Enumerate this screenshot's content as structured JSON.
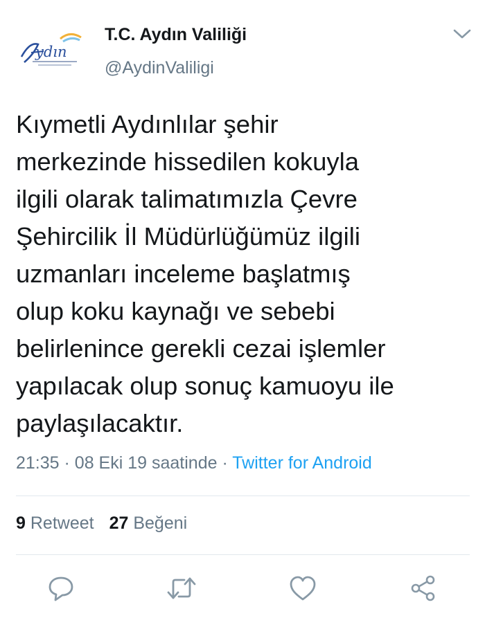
{
  "account": {
    "display_name": "T.C. Aydın Valiliği",
    "handle": "@AydinValiligi",
    "avatar_icon": "aydin-logo-icon"
  },
  "tweet": {
    "text": "Kıymetli Aydınlılar şehir\nmerkezinde hissedilen kokuyla\nilgili olarak talimatımızla Çevre\nŞehircilik İl Müdürlüğümüz ilgili\nuzmanları inceleme başlatmış\nolup koku kaynağı ve sebebi\nbelirlenince gerekli cezai işlemler\nyapılacak olup sonuç kamuoyu ile\npaylaşılacaktır.",
    "time": "21:35",
    "date": "08 Eki 19 saatinde",
    "separator": "·",
    "source": "Twitter for Android"
  },
  "stats": {
    "retweet_count": "9",
    "retweet_label": "Retweet",
    "like_count": "27",
    "like_label": "Beğeni"
  },
  "actions": [
    "reply-icon",
    "retweet-icon",
    "like-icon",
    "share-icon"
  ],
  "colors": {
    "text": "#14171a",
    "secondary": "#657786",
    "link": "#1da1f2",
    "divider": "#e1e8ed"
  }
}
